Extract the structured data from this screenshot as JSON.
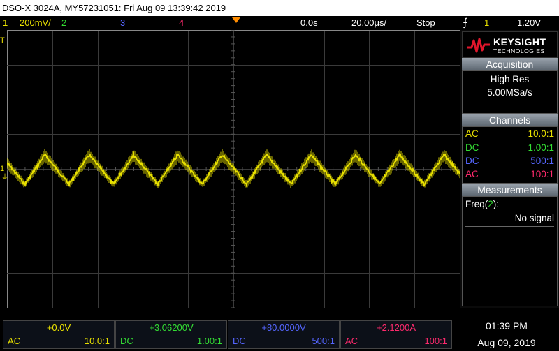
{
  "window": {
    "title": "DSO-X 3024A, MY57231051: Fri Aug 09 13:39:42 2019"
  },
  "status": {
    "ch1_num": "1",
    "ch1_scale": "200mV/",
    "ch2_num": "2",
    "ch3_num": "3",
    "ch4_num": "4",
    "time_offset": "0.0s",
    "time_scale": "20.00μs/",
    "run_state": "Stop",
    "trigger_channel": "1",
    "trigger_level": "1.20V"
  },
  "brand": {
    "name": "KEYSIGHT",
    "sub": "TECHNOLOGIES"
  },
  "acquisition": {
    "header": "Acquisition",
    "mode": "High Res",
    "rate": "5.00MSa/s"
  },
  "channels": {
    "header": "Channels",
    "rows": [
      {
        "coupling": "AC",
        "probe": "10.0:1",
        "color": "#e8e000"
      },
      {
        "coupling": "DC",
        "probe": "1.00:1",
        "color": "#33dd33"
      },
      {
        "coupling": "DC",
        "probe": "500:1",
        "color": "#5566ff"
      },
      {
        "coupling": "AC",
        "probe": "100:1",
        "color": "#ff2a6d"
      }
    ]
  },
  "measurements": {
    "header": "Measurements",
    "label_prefix": "Freq(",
    "label_ch": "2",
    "label_suffix": "):",
    "value": "No signal"
  },
  "bottom_channels": [
    {
      "offset": "+0.0V",
      "coupling": "AC",
      "probe": "10.0:1",
      "color": "#e8e000"
    },
    {
      "offset": "+3.06200V",
      "coupling": "DC",
      "probe": "1.00:1",
      "color": "#33dd33"
    },
    {
      "offset": "+80.0000V",
      "coupling": "DC",
      "probe": "500:1",
      "color": "#5566ff"
    },
    {
      "offset": "+2.1200A",
      "coupling": "AC",
      "probe": "100:1",
      "color": "#ff2a6d"
    }
  ],
  "clock": {
    "time": "01:39 PM",
    "date": "Aug 09, 2019"
  },
  "markers": {
    "ground": "1",
    "trigger": "T"
  },
  "colors": {
    "ch1": "#e8e000",
    "ch2": "#33dd33",
    "ch3": "#5566ff",
    "ch4": "#ff2a6d",
    "trigger_marker": "#ff8c00",
    "logo_red": "#e0162b"
  }
}
